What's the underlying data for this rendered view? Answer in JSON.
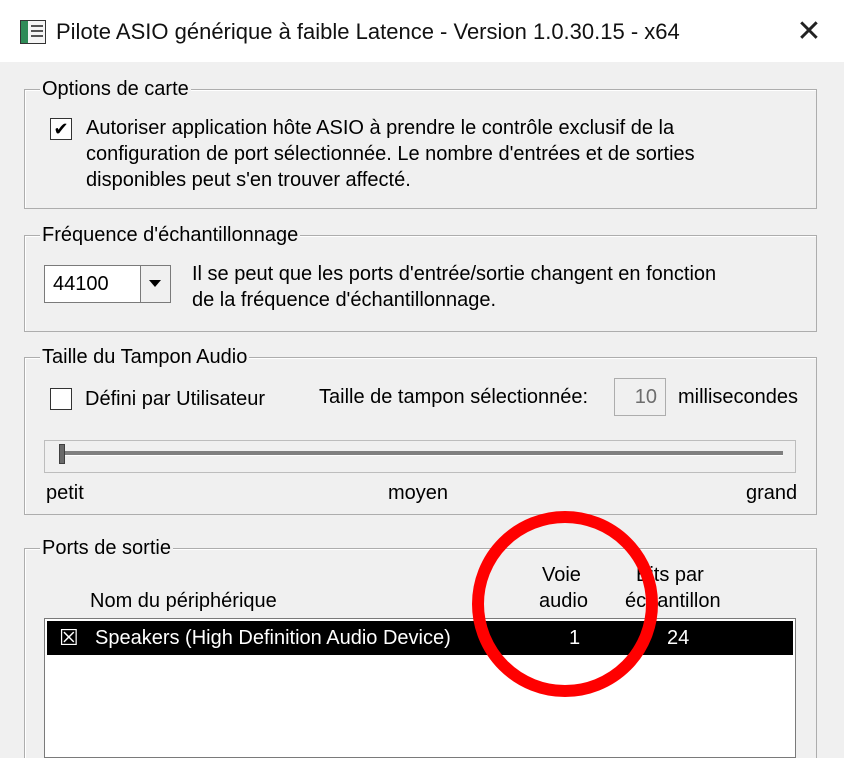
{
  "window": {
    "title": "Pilote ASIO générique à faible Latence - Version 1.0.30.15 - x64",
    "close_glyph": "✕"
  },
  "card_options": {
    "legend": "Options de carte",
    "exclusive": {
      "checked": true,
      "check_glyph": "✔",
      "lines": [
        "Autoriser application hôte ASIO à prendre le contrôle exclusif de la",
        "configuration de port sélectionnée. Le nombre d'entrées et de sorties",
        "disponibles peut s'en trouver affecté."
      ]
    }
  },
  "sample_rate": {
    "legend": "Fréquence d'échantillonnage",
    "value": "44100",
    "note_lines": [
      "Il se peut que les ports d'entrée/sortie changent en fonction",
      "de la fréquence d'échantillonnage."
    ]
  },
  "buffer": {
    "legend": "Taille du Tampon Audio",
    "user_defined_label": "Défini par Utilisateur",
    "user_defined_checked": false,
    "selected_size_label": "Taille de tampon sélectionnée:",
    "selected_size_value": "10",
    "unit": "millisecondes",
    "slider_position": 0.0,
    "slider_labels": {
      "min": "petit",
      "mid": "moyen",
      "max": "grand"
    }
  },
  "output_ports": {
    "legend": "Ports de sortie",
    "columns": {
      "device": "Nom du périphérique",
      "channel_line1": "Voie",
      "channel_line2": "audio",
      "bits_line1": "Bits par",
      "bits_line2": "échantillon"
    },
    "rows": [
      {
        "checkbox_glyph": "☒",
        "device": "Speakers (High Definition Audio Device)",
        "channel": "1",
        "bits": "24",
        "selected": true
      }
    ]
  },
  "colors": {
    "highlight": "#ff0000",
    "selection": "#000000",
    "dialog_bg": "#f0f0f0"
  }
}
